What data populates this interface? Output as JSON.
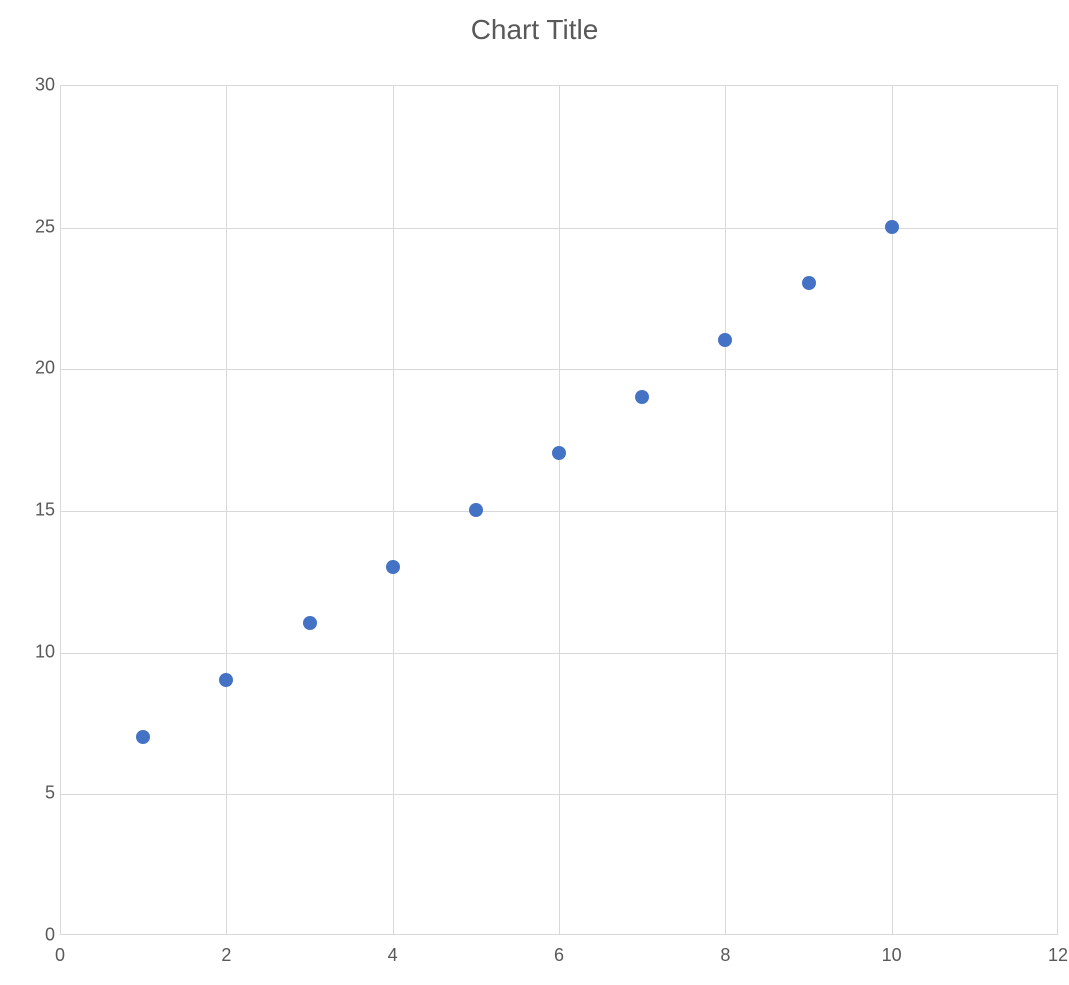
{
  "chart_data": {
    "type": "scatter",
    "title": "Chart Title",
    "xlabel": "",
    "ylabel": "",
    "xlim": [
      0,
      12
    ],
    "ylim": [
      0,
      30
    ],
    "x_ticks": [
      0,
      2,
      4,
      6,
      8,
      10,
      12
    ],
    "y_ticks": [
      0,
      5,
      10,
      15,
      20,
      25,
      30
    ],
    "grid": true,
    "marker_color": "#4472c4",
    "x": [
      1,
      2,
      3,
      4,
      5,
      6,
      7,
      8,
      9,
      10
    ],
    "y": [
      7,
      9,
      11,
      13,
      15,
      17,
      19,
      21,
      23,
      25
    ]
  }
}
